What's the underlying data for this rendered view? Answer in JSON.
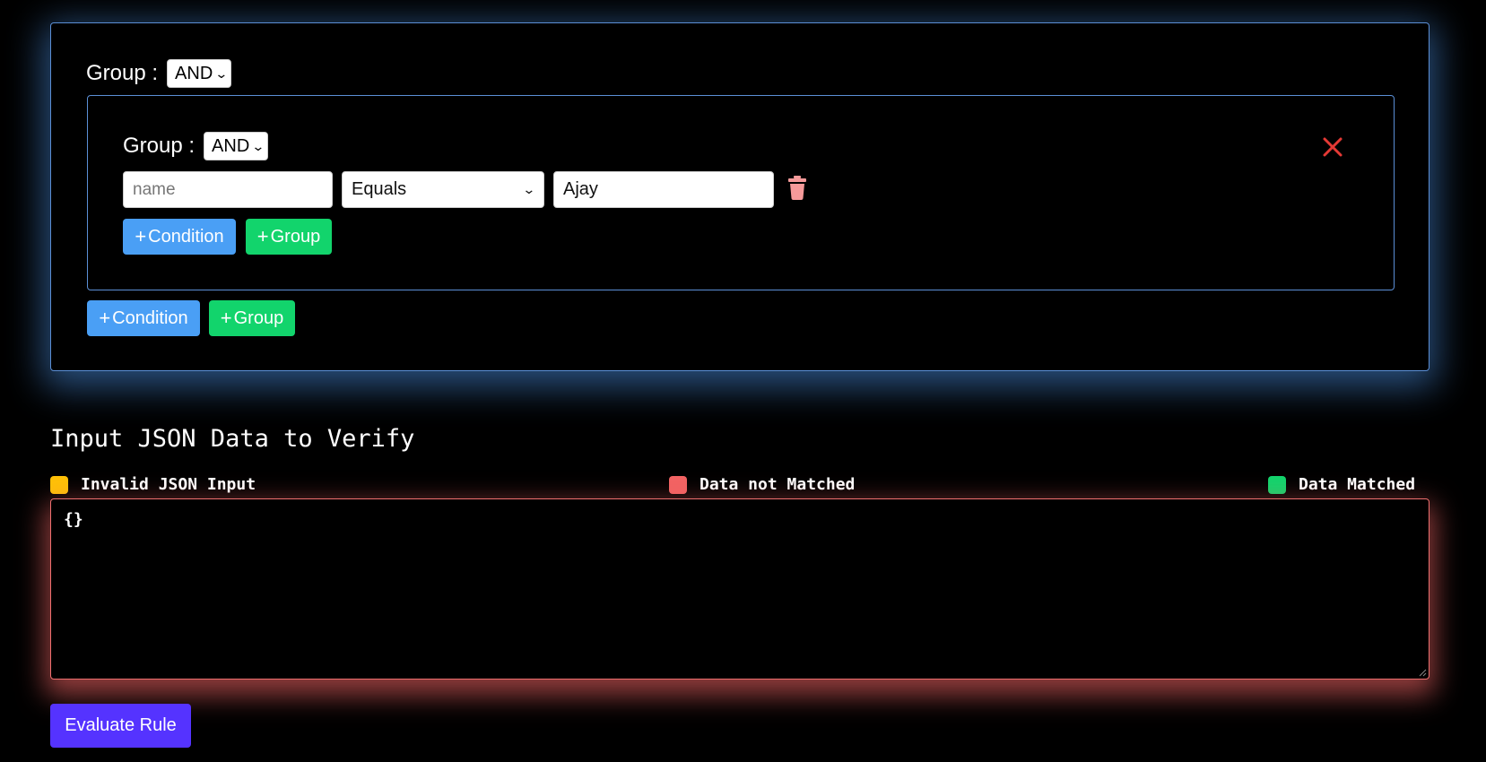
{
  "outer_group": {
    "label": "Group :",
    "logic_value": "AND",
    "add_condition_label": "Condition",
    "add_group_label": "Group"
  },
  "inner_group": {
    "label": "Group :",
    "logic_value": "AND",
    "condition": {
      "field_placeholder": "name",
      "field_value": "",
      "operator_value": "Equals",
      "value": "Ajay"
    },
    "add_condition_label": "Condition",
    "add_group_label": "Group"
  },
  "json_section": {
    "title": "Input JSON Data to Verify",
    "legend": [
      {
        "label": "Invalid JSON Input",
        "color": "#ffc107"
      },
      {
        "label": "Data not Matched",
        "color": "#f26363"
      },
      {
        "label": "Data Matched",
        "color": "#12d46c"
      }
    ],
    "textarea_value": "{}"
  },
  "evaluate_button_label": "Evaluate Rule",
  "colors": {
    "group_border": "#5b8fd6",
    "add_condition_bg": "#4a9ff5",
    "add_group_bg": "#12d46c",
    "evaluate_bg": "#5533ff",
    "delete_icon": "#f59a9a",
    "close_icon": "#e53935",
    "textarea_border": "#f07070"
  },
  "icons": {
    "delete": "trash-icon",
    "remove_group": "close-icon",
    "add": "plus-icon",
    "dropdown": "chevron-down-icon"
  }
}
